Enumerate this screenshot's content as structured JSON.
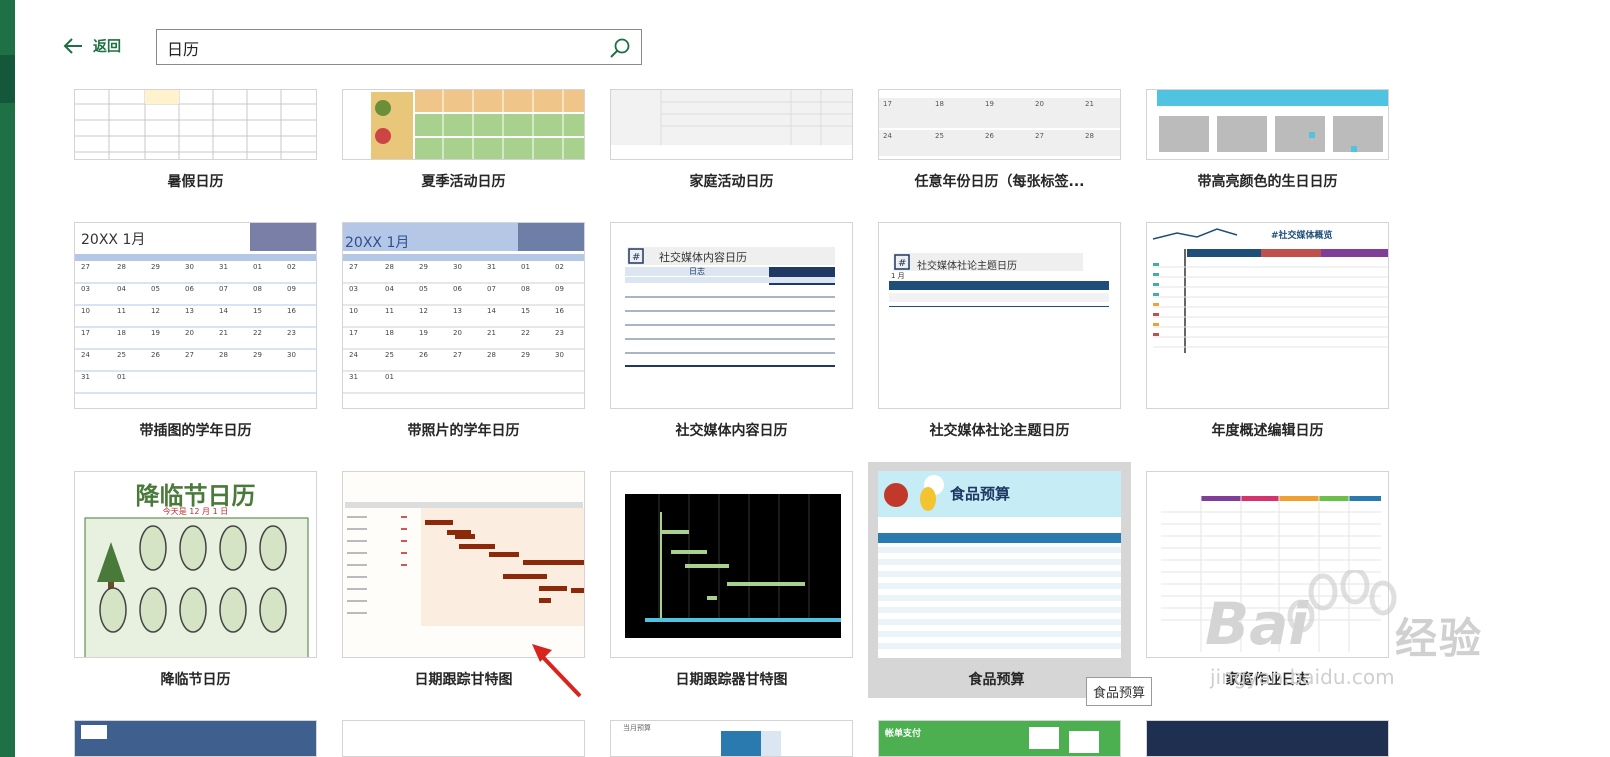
{
  "nav": {
    "back_label": "返回"
  },
  "search": {
    "value": "日历",
    "placeholder": ""
  },
  "templates": [
    {
      "label": "暑假日历"
    },
    {
      "label": "夏季活动日历"
    },
    {
      "label": "家庭活动日历"
    },
    {
      "label": "任意年份日历（每张标签..."
    },
    {
      "label": "带高亮颜色的生日日历"
    },
    {
      "label": "带插图的学年日历",
      "preview_title": "20XX 1月"
    },
    {
      "label": "带照片的学年日历",
      "preview_title": "20XX 1月"
    },
    {
      "label": "社交媒体内容日历",
      "preview_title": "社交媒体内容日历",
      "preview_sub": "日志"
    },
    {
      "label": "社交媒体社论主题日历",
      "preview_title": "社交媒体社论主题日历",
      "preview_sub": "1 月"
    },
    {
      "label": "年度概述编辑日历",
      "preview_title": "#社交媒体概览"
    },
    {
      "label": "降临节日历",
      "preview_title": "降临节日历",
      "preview_sub": "今天是 12 月 1 日"
    },
    {
      "label": "日期跟踪甘特图"
    },
    {
      "label": "日期跟踪器甘特图"
    },
    {
      "label": "食品预算",
      "preview_title": "食品预算"
    },
    {
      "label": "家庭作业日志"
    },
    {
      "label": ""
    },
    {
      "label": ""
    },
    {
      "label": "",
      "preview_title": "当月预算"
    },
    {
      "label": "",
      "preview_title": "帐单支付"
    },
    {
      "label": ""
    }
  ],
  "tooltip": {
    "text": "食品预算"
  },
  "watermark": {
    "brand": "Bai",
    "brand_cn": "经验",
    "url": "jingyan.baidu.com"
  },
  "colors": {
    "excel_green": "#1e7145",
    "back_text": "#1e6f43",
    "hover_bg": "#d6d6d6"
  }
}
